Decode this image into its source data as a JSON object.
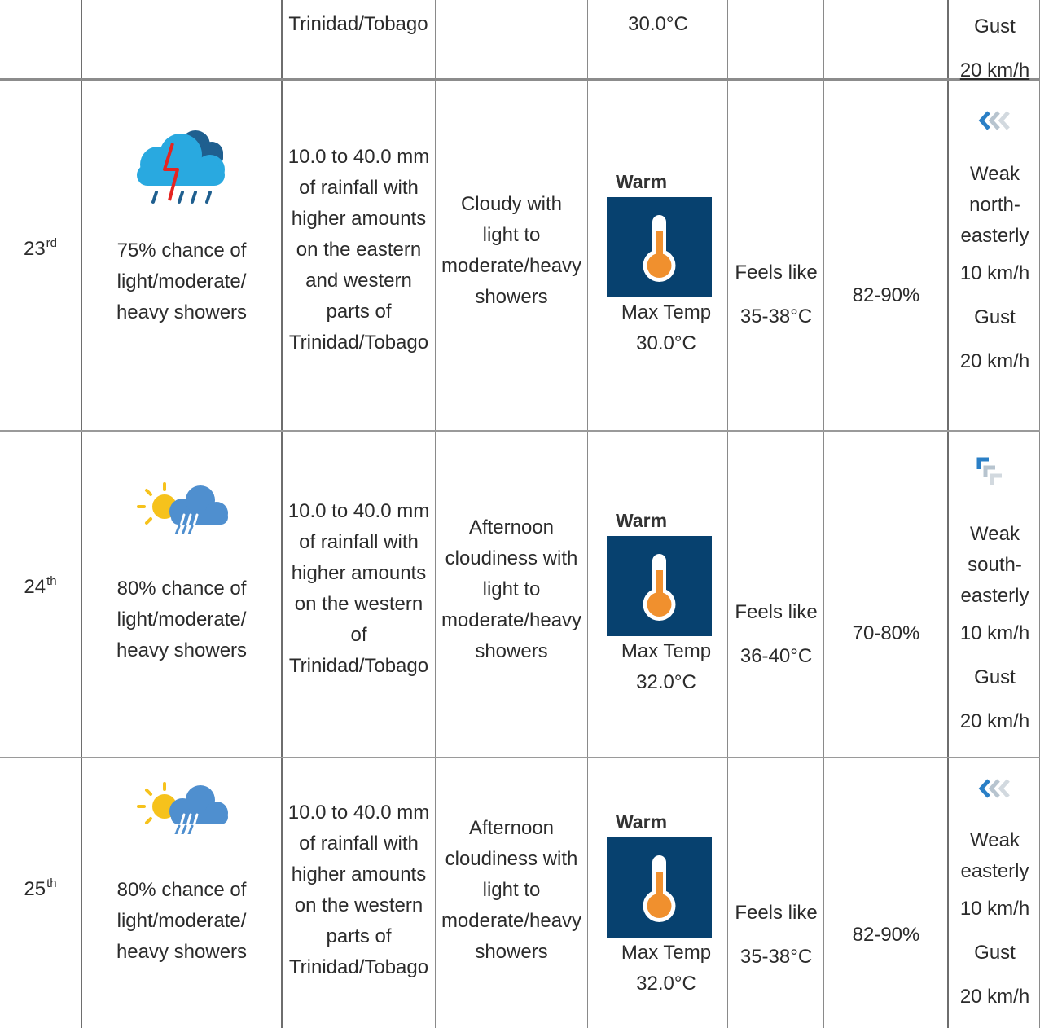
{
  "top_row": {
    "rainfall_tail": "Trinidad/Tobago",
    "max_temp_tail": "30.0°C",
    "wind_gust_label": "Gust",
    "wind_gust_value": "20 km/h"
  },
  "rows": [
    {
      "date_num": "23",
      "date_suffix": "rd",
      "icon": "thunderstorm-rain-cloud-icon",
      "chance": [
        "75% chance of",
        "light/moderate/",
        "heavy  showers"
      ],
      "rainfall": [
        "10.0 to 40.0 mm",
        "of rainfall with",
        "higher amounts",
        "on the eastern",
        "and western",
        "parts of",
        "Trinidad/Tobago"
      ],
      "sky": [
        "Cloudy with",
        "light to",
        "moderate/heavy",
        "showers"
      ],
      "temp_label": "Warm",
      "max_temp_label": "Max Temp",
      "max_temp_value": "30.0°C",
      "feels_like_label": "Feels like",
      "feels_like_value": "35-38°C",
      "humidity": "82-90%",
      "wind_arrow_icon": "wind-arrow-west-icon",
      "wind": [
        "Weak",
        "north-",
        "easterly"
      ],
      "wind_speed": "10 km/h",
      "gust_label": "Gust",
      "gust_value": "20 km/h"
    },
    {
      "date_num": "24",
      "date_suffix": "th",
      "icon": "sun-rain-cloud-icon",
      "chance": [
        "80% chance of",
        "light/moderate/",
        "heavy  showers"
      ],
      "rainfall": [
        "10.0 to 40.0 mm",
        "of rainfall with",
        "higher amounts",
        "on the western",
        "of",
        "Trinidad/Tobago"
      ],
      "sky": [
        "Afternoon",
        "cloudiness with",
        "light to",
        "moderate/heavy",
        "showers"
      ],
      "temp_label": "Warm",
      "max_temp_label": "Max Temp",
      "max_temp_value": "32.0°C",
      "feels_like_label": "Feels like",
      "feels_like_value": "36-40°C",
      "humidity": "70-80%",
      "wind_arrow_icon": "wind-arrow-northwest-icon",
      "wind": [
        "Weak",
        "south-",
        "easterly"
      ],
      "wind_speed": "10 km/h",
      "gust_label": "Gust",
      "gust_value": "20 km/h"
    },
    {
      "date_num": "25",
      "date_suffix": "th",
      "icon": "sun-rain-cloud-icon",
      "chance": [
        "80% chance of",
        "light/moderate/",
        "heavy  showers"
      ],
      "rainfall": [
        "10.0 to 40.0 mm",
        "of rainfall with",
        "higher amounts",
        "on the western",
        "parts of",
        "Trinidad/Tobago"
      ],
      "sky": [
        "Afternoon",
        "cloudiness with",
        "light to",
        "moderate/heavy",
        "showers"
      ],
      "temp_label": "Warm",
      "max_temp_label": "Max Temp",
      "max_temp_value": "32.0°C",
      "feels_like_label": "Feels like",
      "feels_like_value": "35-38°C",
      "humidity": "82-90%",
      "wind_arrow_icon": "wind-arrow-west-icon",
      "wind": [
        "Weak",
        "easterly"
      ],
      "wind_speed": "10 km/h",
      "gust_label": "Gust",
      "gust_value": "20 km/h"
    }
  ],
  "colors": {
    "thermo_bg": "#07416f",
    "thermo_bulb": "#f0902e",
    "cloud_blue": "#29a9e0",
    "cloud_dark": "#1f5f8f",
    "lightning": "#e52421",
    "sun": "#f6c21c",
    "arrow_blue": "#2a7fc6"
  }
}
